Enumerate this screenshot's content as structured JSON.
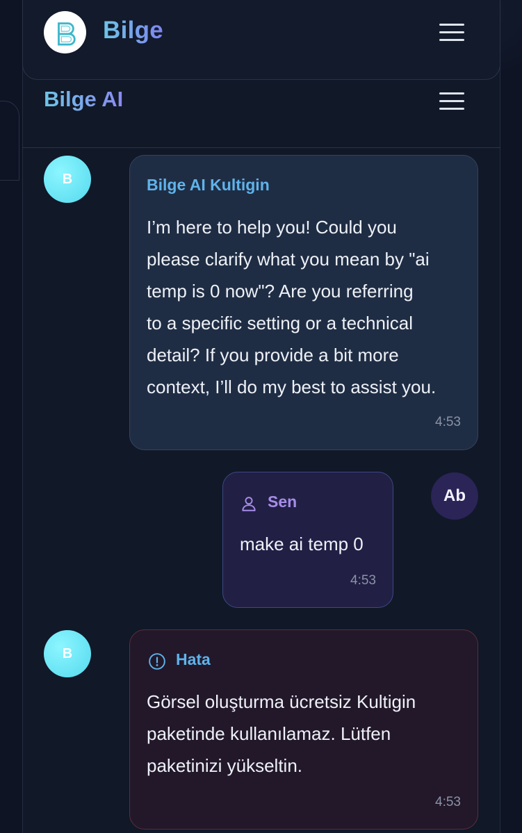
{
  "header": {
    "brand": "Bilge",
    "logo_letter": "B",
    "menu_icon": "hamburger-menu-icon"
  },
  "chat": {
    "title": "Bilge AI",
    "menu_icon": "hamburger-menu-icon"
  },
  "messages": [
    {
      "role": "assistant",
      "avatar": "B",
      "sender": "Bilge AI Kultigin",
      "lines": [
        "I’m here to help you! Could you",
        "please clarify what you mean by \"ai",
        "temp is 0 now\"? Are you referring",
        "to a specific setting or a technical",
        "detail? If you provide a bit more",
        "context, I’ll do my best to assist you."
      ],
      "time": "4:53"
    },
    {
      "role": "user",
      "avatar": "Ab",
      "sender": "Sen",
      "sender_icon": "user-icon",
      "lines": [
        "make ai temp 0"
      ],
      "time": "4:53"
    },
    {
      "role": "error",
      "avatar": "B",
      "sender": "Hata",
      "sender_icon": "alert-circle-icon",
      "lines": [
        "Görsel oluşturma ücretsiz Kultigin",
        "paketinde kullanılamaz. Lütfen",
        "paketinizi yükseltin."
      ],
      "time": "4:53"
    }
  ],
  "colors": {
    "background": "#0e1424",
    "accent_blue": "#5fb3ea",
    "accent_purple": "#a68de8",
    "bot_avatar": "#55d9ee",
    "user_avatar": "#2a2457"
  }
}
